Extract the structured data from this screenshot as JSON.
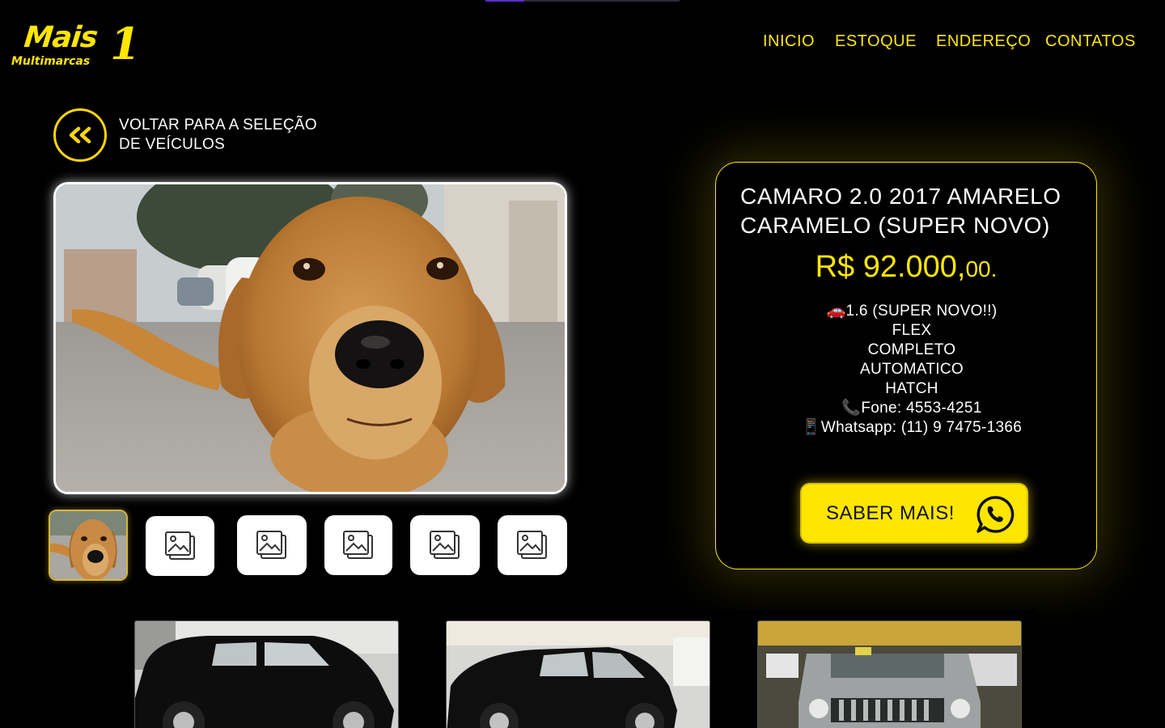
{
  "brand": {
    "logo_text": "Mais",
    "logo_number": "1",
    "logo_subtitle": "Multimarcas",
    "accent_color": "#ffe600"
  },
  "nav": {
    "items": [
      {
        "label": "INICIO"
      },
      {
        "label": "ESTOQUE"
      },
      {
        "label": "ENDEREÇO"
      },
      {
        "label": "CONTATOS"
      }
    ]
  },
  "back": {
    "label": "VOLTAR PARA A SELEÇÃO DE VEÍCULOS",
    "icon": "double-chevron-left-icon"
  },
  "vehicle": {
    "title": "CAMARO 2.0 2017 AMARELO CARAMELO (SUPER NOVO)",
    "price_main": "R$ 92.000,",
    "price_cents": "00.",
    "specs": [
      "🚗1.6 (SUPER NOVO!!)",
      "FLEX",
      "COMPLETO",
      "AUTOMATICO",
      "HATCH",
      "📞Fone: 4553-4251",
      "📱Whatsapp: (11) 9 7475-1366"
    ],
    "cta_label": "SABER MAIS!",
    "cta_icon": "whatsapp-icon"
  },
  "photos": {
    "main_image": "dog-photo",
    "thumbnails": [
      {
        "type": "photo"
      },
      {
        "type": "placeholder",
        "icon": "image-placeholder-icon"
      },
      {
        "type": "placeholder",
        "icon": "image-placeholder-icon"
      },
      {
        "type": "placeholder",
        "icon": "image-placeholder-icon"
      },
      {
        "type": "placeholder",
        "icon": "image-placeholder-icon"
      },
      {
        "type": "placeholder",
        "icon": "image-placeholder-icon"
      }
    ]
  },
  "related": {
    "cars": [
      {
        "image": "black-hatchback-1"
      },
      {
        "image": "black-hatchback-2"
      },
      {
        "image": "silver-suv"
      }
    ]
  }
}
